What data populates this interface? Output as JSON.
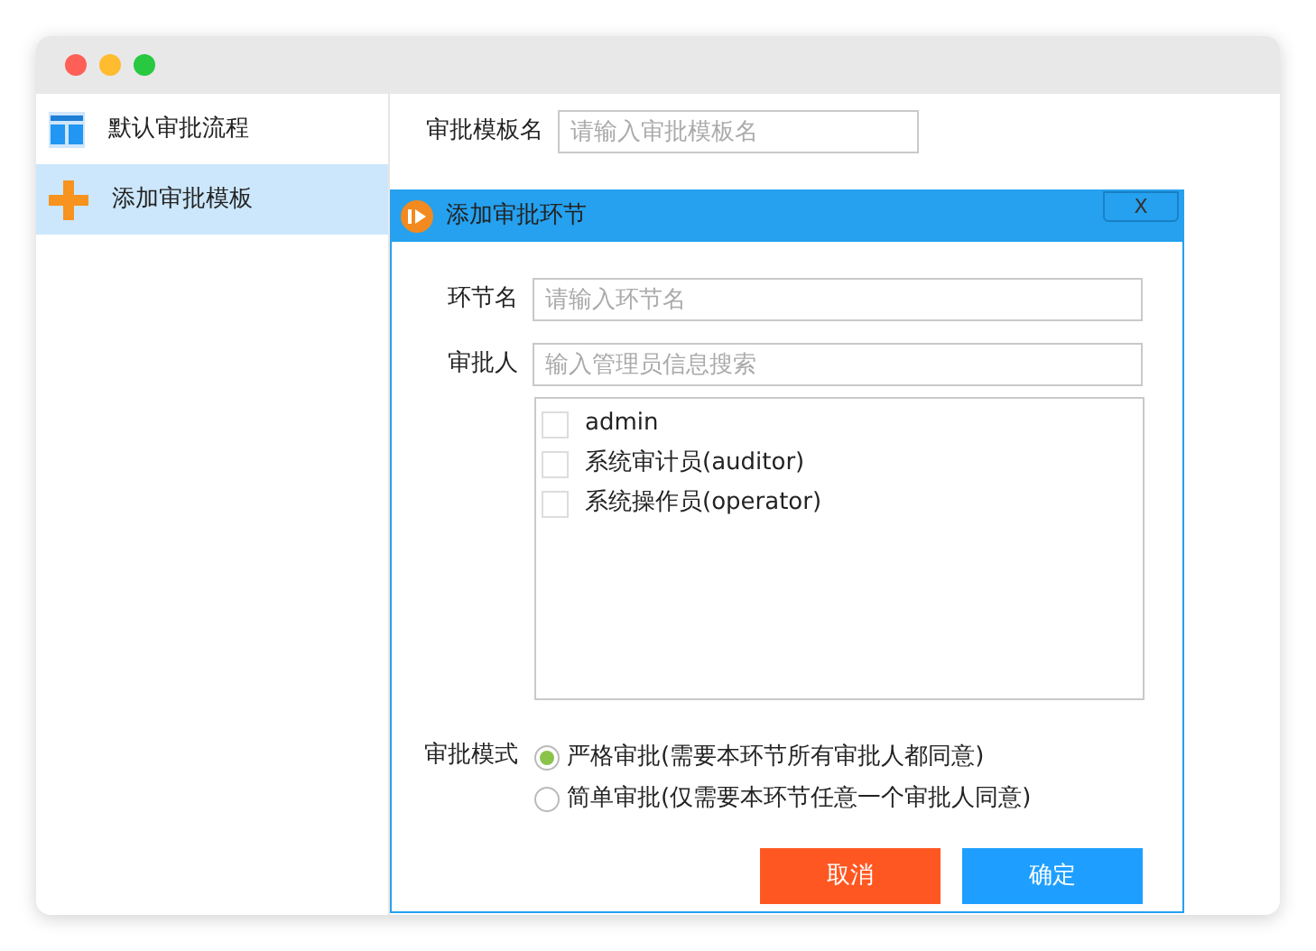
{
  "sidebar": {
    "items": [
      {
        "label": "默认审批流程",
        "selected": false
      },
      {
        "label": "添加审批模板",
        "selected": true
      }
    ]
  },
  "form": {
    "template_name": {
      "label": "审批模板名",
      "placeholder": "请输入审批模板名"
    }
  },
  "dialog": {
    "title": "添加审批环节",
    "close": "X",
    "step_name": {
      "label": "环节名",
      "placeholder": "请输入环节名"
    },
    "approver": {
      "label": "审批人",
      "placeholder": "输入管理员信息搜索"
    },
    "approvers": [
      {
        "label": "admin",
        "checked": false
      },
      {
        "label": "系统审计员(auditor)",
        "checked": false
      },
      {
        "label": "系统操作员(operator)",
        "checked": false
      }
    ],
    "mode": {
      "label": "审批模式",
      "options": [
        {
          "label": "严格审批(需要本环节所有审批人都同意)",
          "selected": true
        },
        {
          "label": "简单审批(仅需要本环节任意一个审批人同意)",
          "selected": false
        }
      ]
    },
    "buttons": [
      {
        "label": "取消",
        "kind": "cancel"
      },
      {
        "label": "确定",
        "kind": "confirm"
      }
    ]
  }
}
